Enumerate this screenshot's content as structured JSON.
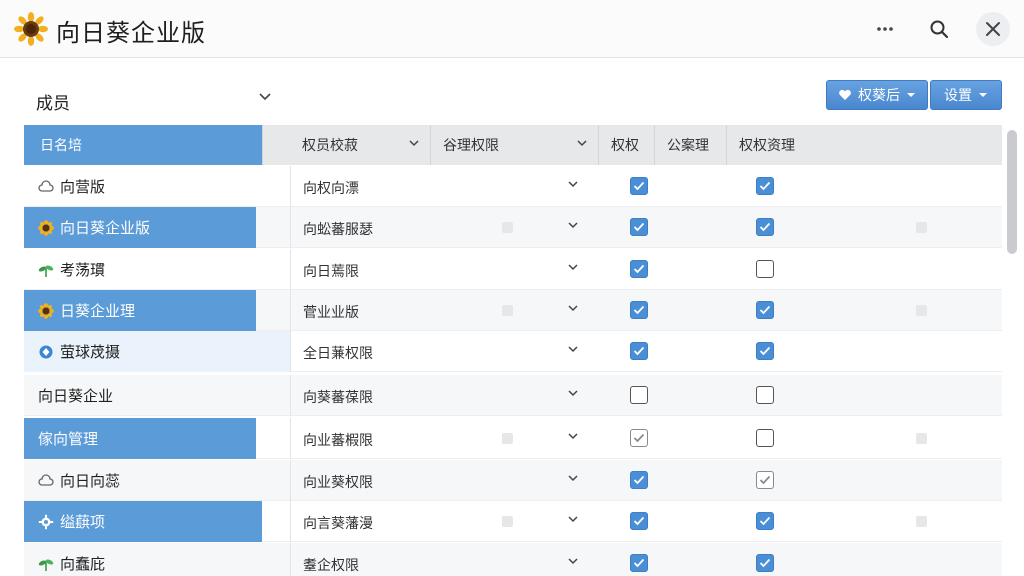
{
  "app": {
    "title": "向日葵企业版",
    "logo_icon": "sunflower-icon"
  },
  "titlebar": {
    "more_icon": "more-horizontal-icon",
    "search_icon": "search-icon",
    "close_icon": "close-icon"
  },
  "toolbar": {
    "members_label": "成员",
    "perm_button_label": "权葵后",
    "settings_button_label": "设置"
  },
  "table": {
    "headers": {
      "name": "日名培",
      "role": "权员校菽",
      "scope": "谷理权限",
      "perm1": "权权",
      "perm2": "公案理",
      "perm3": "权权资理"
    },
    "rows": [
      {
        "name": "向营版",
        "icon": "cloud-outline-icon",
        "role": "向权向漂",
        "perm1": "on",
        "perm2": "on"
      },
      {
        "name": "向日葵企业版",
        "icon": "sunflower-icon",
        "role": "向蚣蕃服瑟",
        "perm1": "on",
        "perm2": "on"
      },
      {
        "name": "考荡瑻",
        "icon": "sprout-icon",
        "role": "向日蔫限",
        "perm1": "on",
        "perm2": "off"
      },
      {
        "name": "日葵企业理",
        "icon": "sunflower-icon",
        "role": "菅业业版",
        "perm1": "on",
        "perm2": "on"
      },
      {
        "name": "萤球荗摄",
        "icon": "diamond-icon",
        "role": "全日蒹权限",
        "perm1": "on",
        "perm2": "on"
      },
      {
        "name": "向日葵企业",
        "icon": "",
        "role": "向葵蕃葆限",
        "perm1": "off",
        "perm2": "off"
      },
      {
        "name": "傢向管理",
        "icon": "",
        "role": "向业蕃椵限",
        "perm1": "grey",
        "perm2": "off"
      },
      {
        "name": "向日向蕊",
        "icon": "cloud-outline-icon",
        "role": "向业葵权限",
        "perm1": "on",
        "perm2": "grey"
      },
      {
        "name": "缢蕻项",
        "icon": "gear-icon",
        "role": "向言葵藩漫",
        "perm1": "on",
        "perm2": "on"
      },
      {
        "name": "向蠢庇",
        "icon": "sprout-icon",
        "role": "耋企权限",
        "perm1": "on",
        "perm2": "on"
      }
    ]
  },
  "colors": {
    "accent": "#5b9bd8",
    "checkbox": "#4a8fd6",
    "header_bg": "#e7e8ea"
  }
}
